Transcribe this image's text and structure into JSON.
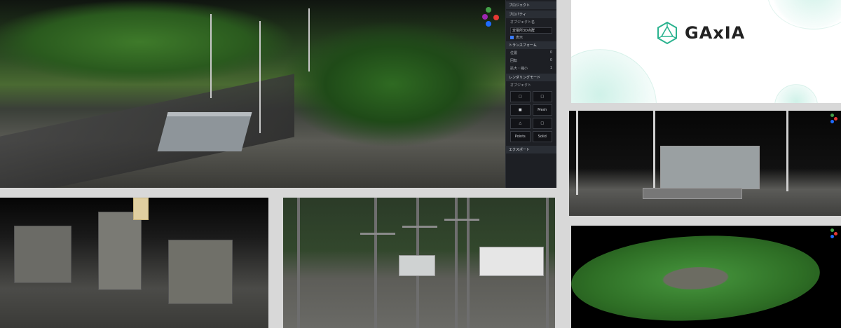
{
  "brand": {
    "name": "GAxIA",
    "accent": "#2bb38f"
  },
  "viewer": {
    "properties_panel": {
      "header_items": [
        "プロジェクト",
        "プロパティ"
      ],
      "object_section": {
        "label": "オブジェクト名",
        "value": "変電所3D点群",
        "checkbox_label": "表示"
      },
      "transform_section": {
        "title": "トランスフォーム",
        "rows": [
          {
            "label": "位置",
            "value": "0"
          },
          {
            "label": "回転",
            "value": "0"
          },
          {
            "label": "拡大・縮小",
            "value": "1"
          }
        ]
      },
      "render_section": {
        "title": "レンダリングモード",
        "subtitle": "オブジェクト",
        "buttons": [
          "□",
          "□",
          "■",
          "Mesh",
          "△",
          "□",
          "Points",
          "Solid"
        ]
      },
      "footer_section": {
        "title": "エクスポート"
      }
    },
    "gizmo_colors": {
      "x": "#e53935",
      "y": "#43a047",
      "z": "#1e6bff"
    }
  }
}
